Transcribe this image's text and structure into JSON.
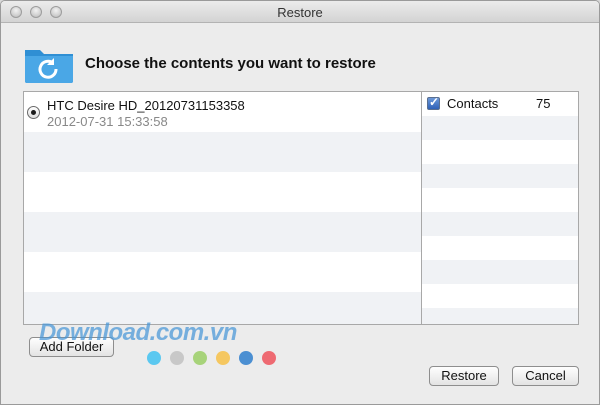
{
  "window": {
    "title": "Restore"
  },
  "header": {
    "text": "Choose the contents you want to restore",
    "icon": "folder-restore-icon"
  },
  "backups": [
    {
      "name": "HTC Desire HD_20120731153358",
      "date": "2012-07-31 15:33:58",
      "selected": true
    }
  ],
  "contents": [
    {
      "label": "Contacts",
      "count": "75",
      "checked": true
    }
  ],
  "buttons": {
    "add_folder": "Add Folder",
    "restore": "Restore",
    "cancel": "Cancel"
  },
  "watermark": {
    "text": "Download.com.vn",
    "dot_colors": [
      "#5bc8f0",
      "#c8c8c8",
      "#a7d37a",
      "#f5c760",
      "#4b8fd2",
      "#ee6a72"
    ]
  },
  "colors": {
    "folder_icon": "#4aa7e6",
    "selection_check": "#3a6fc4"
  }
}
